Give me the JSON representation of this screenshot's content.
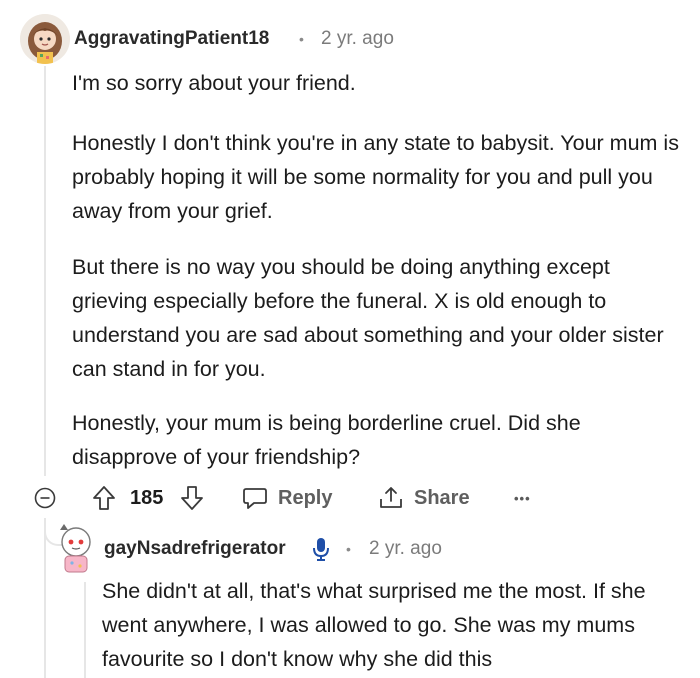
{
  "comment": {
    "username": "AggravatingPatient18",
    "separator": "•",
    "time": "2 yr. ago",
    "paragraphs": [
      "I'm so sorry about your friend.",
      "Honestly I don't think you're in any state to babysit. Your mum is probably hoping it will be some normality for you and pull you away from your grief.",
      "But there is no way you should be doing anything except grieving especially before the funeral. X is old enough to understand you are sad about something and your older sister can stand in for you.",
      "Honestly, your mum is being borderline cruel. Did she disapprove of your friendship?"
    ],
    "vote_count": "185",
    "reply_label": "Reply",
    "share_label": "Share",
    "more_label": "•••"
  },
  "reply": {
    "username": "gayNsadrefrigerator",
    "separator": "•",
    "time": "2 yr. ago",
    "paragraphs": [
      "She didn't at all, that's what surprised me the most. If she went anywhere, I was allowed to go. She was my mums favourite so I don't know why she did this"
    ]
  },
  "colors": {
    "text": "#1c1c1c",
    "muted": "#7b7b7b",
    "thread_line": "#e6e6e6",
    "reply_avatar_bg": "#f7b6c8"
  },
  "icons": {
    "collapse": "minus-circle-icon",
    "upvote": "arrow-up-icon",
    "downvote": "arrow-down-icon",
    "reply": "speech-bubble-icon",
    "share": "share-icon",
    "more": "ellipsis-icon",
    "mic": "microphone-icon"
  }
}
